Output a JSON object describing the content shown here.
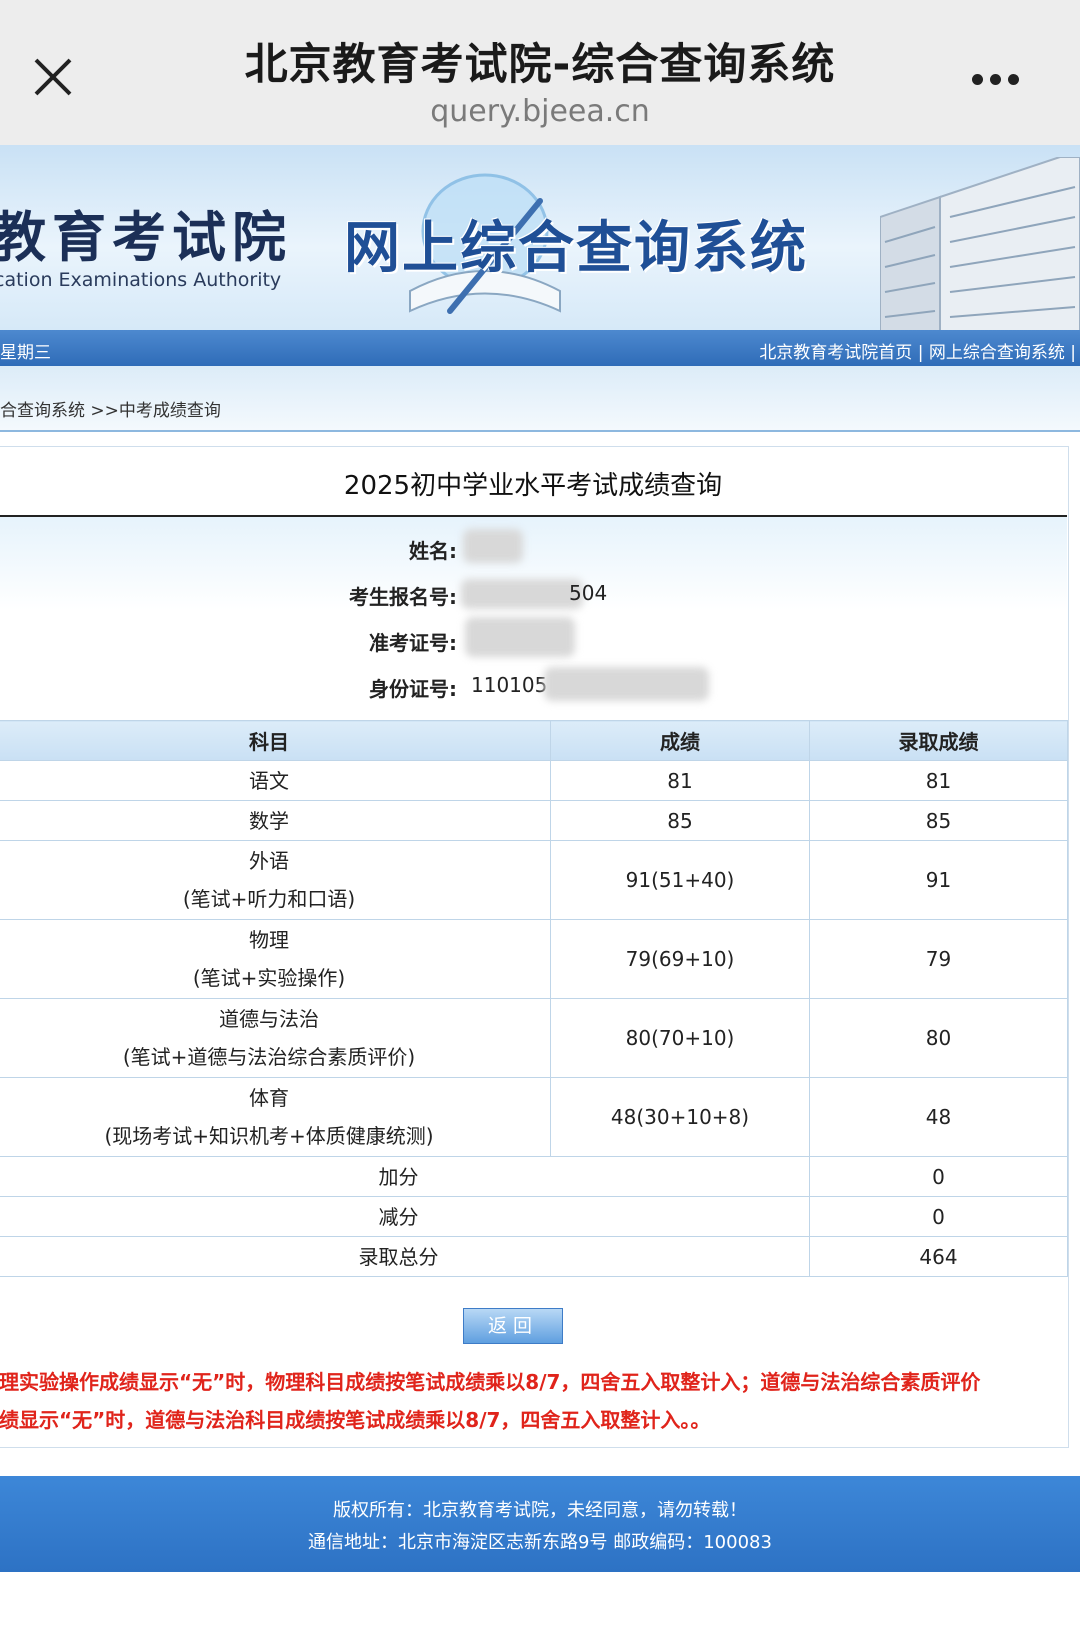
{
  "browser": {
    "title": "北京教育考试院-综合查询系统",
    "url": "query.bjeea.cn"
  },
  "banner": {
    "org_name": "教育考试院",
    "org_name_en": "cation Examinations Authority",
    "system_title": "网上综合查询系统"
  },
  "nav": {
    "date_text": "星期三",
    "links": [
      "北京教育考试院首页",
      "网上综合查询系统"
    ],
    "separator": "|"
  },
  "breadcrumb": "合查询系统 >>中考成绩查询",
  "page_title": "2025初中学业水平考试成绩查询",
  "student_info": {
    "name_label": "姓名:",
    "name_value": "",
    "reg_label": "考生报名号:",
    "reg_value": "504",
    "ticket_label": "准考证号:",
    "ticket_value": "",
    "id_label": "身份证号:",
    "id_value": "110105"
  },
  "table": {
    "headers": [
      "科目",
      "成绩",
      "录取成绩"
    ],
    "rows": [
      {
        "subject": "语文",
        "sub": "",
        "score": "81",
        "admission": "81"
      },
      {
        "subject": "数学",
        "sub": "",
        "score": "85",
        "admission": "85"
      },
      {
        "subject": "外语",
        "sub": "(笔试+听力和口语)",
        "score": "91(51+40)",
        "admission": "91"
      },
      {
        "subject": "物理",
        "sub": "(笔试+实验操作)",
        "score": "79(69+10)",
        "admission": "79"
      },
      {
        "subject": "道德与法治",
        "sub": "(笔试+道德与法治综合素质评价)",
        "score": "80(70+10)",
        "admission": "80"
      },
      {
        "subject": "体育",
        "sub": "(现场考试+知识机考+体质健康统测)",
        "score": "48(30+10+8)",
        "admission": "48"
      }
    ],
    "summary": [
      {
        "label": "加分",
        "value": "0"
      },
      {
        "label": "减分",
        "value": "0"
      },
      {
        "label": "录取总分",
        "value": "464"
      }
    ]
  },
  "back_button": "返回",
  "note_lines": [
    "理实验操作成绩显示“无”时，物理科目成绩按笔试成绩乘以8/7，四舍五入取整计入；道德与法治综合素质评价",
    "绩显示“无”时，道德与法治科目成绩按笔试成绩乘以8/7，四舍五入取整计入。。"
  ],
  "footer": {
    "line1": "版权所有：北京教育考试院，未经同意，请勿转载！",
    "line2": "通信地址：北京市海淀区志新东路9号 邮政编码：100083"
  },
  "colors": {
    "nav_blue": "#2f6cb8",
    "footer_blue": "#2d72c4",
    "note_red": "#e0241b",
    "table_header": "#c9e0f4"
  }
}
